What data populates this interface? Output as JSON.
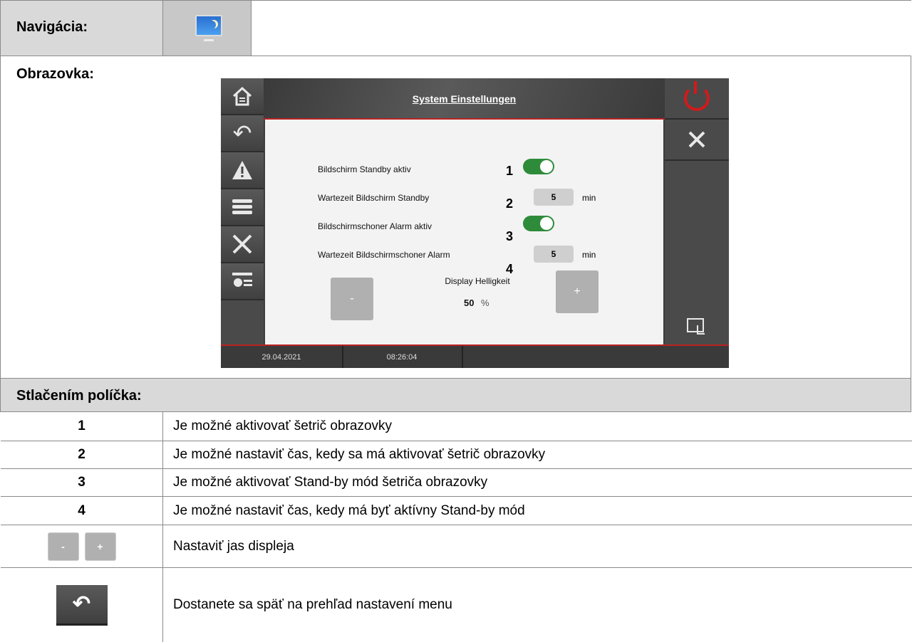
{
  "nav": {
    "label": "Navigácia:",
    "icon": "monitor-moon-icon"
  },
  "screen": {
    "label": "Obrazovka:",
    "hmi": {
      "title": "System Einstellungen",
      "settings": [
        {
          "label": "Bildschirm Standby aktiv",
          "num": "1",
          "kind": "toggle"
        },
        {
          "label": "Wartezeit Bildschirm Standby",
          "num": "2",
          "kind": "value",
          "value": "5",
          "unit": "min"
        },
        {
          "label": "Bildschirmschoner Alarm aktiv",
          "num": "3",
          "kind": "toggle"
        },
        {
          "label": "Wartezeit Bildschirmschoner Alarm",
          "num": "4",
          "kind": "value",
          "value": "5",
          "unit": "min"
        }
      ],
      "brightness": {
        "label": "Display Helligkeit",
        "value": "50",
        "unit": "%",
        "minus": "-",
        "plus": "+"
      },
      "status": {
        "date": "29.04.2021",
        "time": "08:26:04"
      }
    }
  },
  "legend": {
    "header": "Stlačením políčka:",
    "rows": [
      {
        "key": "1",
        "text": "Je možné aktivovať šetrič obrazovky"
      },
      {
        "key": "2",
        "text": "Je možné nastaviť čas, kedy sa má aktivovať šetrič obrazovky"
      },
      {
        "key": "3",
        "text": "Je možné aktivovať Stand-by mód šetriča obrazovky"
      },
      {
        "key": "4",
        "text": "Je možné nastaviť čas, kedy má byť aktívny Stand-by mód"
      },
      {
        "key_minus": "-",
        "key_plus": "+",
        "text": "Nastaviť jas displeja"
      },
      {
        "key_icon": "back-arrow-icon",
        "text": "Dostanete sa späť na prehľad nastavení menu"
      }
    ]
  }
}
